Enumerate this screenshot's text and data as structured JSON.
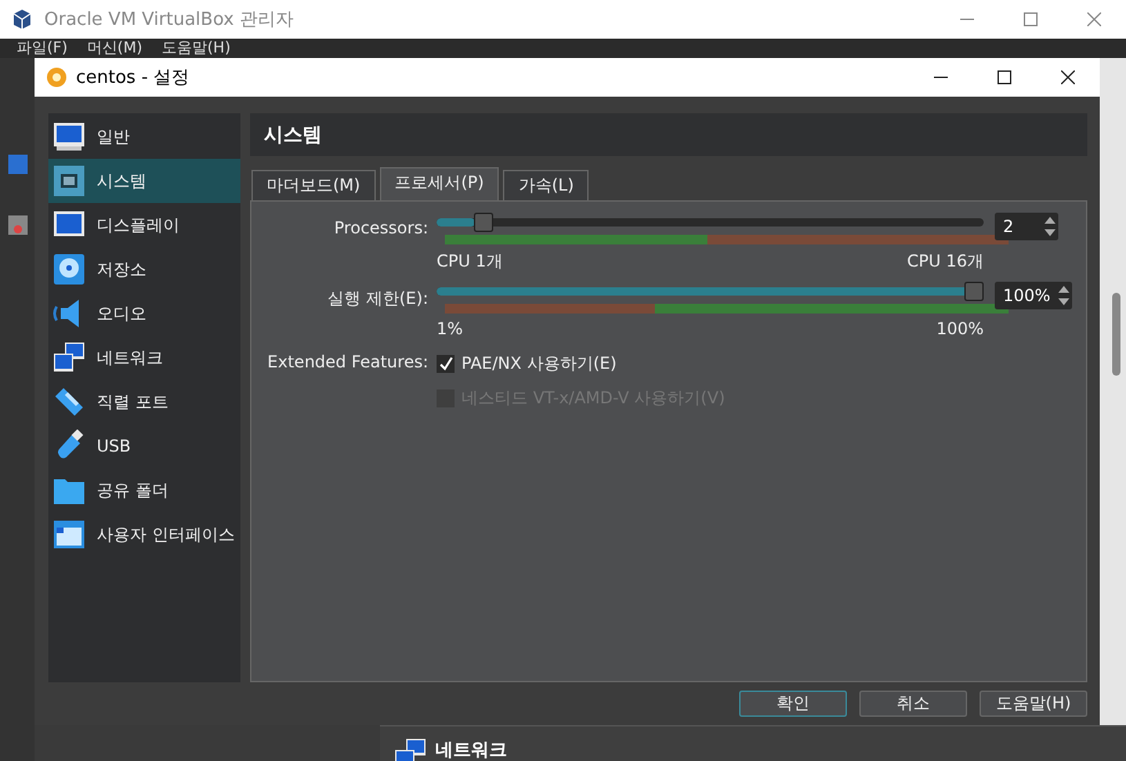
{
  "main_window": {
    "title": "Oracle VM VirtualBox 관리자",
    "menu": [
      "파일(F)",
      "머신(M)",
      "도움말(H)"
    ],
    "details_header": "네트워크"
  },
  "dialog": {
    "title": "centos - 설정",
    "sidebar": {
      "items": [
        {
          "label": "일반",
          "kind": "general",
          "selected": false
        },
        {
          "label": "시스템",
          "kind": "system",
          "selected": true
        },
        {
          "label": "디스플레이",
          "kind": "display",
          "selected": false
        },
        {
          "label": "저장소",
          "kind": "storage",
          "selected": false
        },
        {
          "label": "오디오",
          "kind": "audio",
          "selected": false
        },
        {
          "label": "네트워크",
          "kind": "network",
          "selected": false
        },
        {
          "label": "직렬 포트",
          "kind": "serial",
          "selected": false
        },
        {
          "label": "USB",
          "kind": "usb",
          "selected": false
        },
        {
          "label": "공유 폴더",
          "kind": "folder",
          "selected": false
        },
        {
          "label": "사용자 인터페이스",
          "kind": "ui",
          "selected": false
        }
      ]
    },
    "page_title": "시스템",
    "tabs": [
      {
        "label": "마더보드(M)",
        "selected": false
      },
      {
        "label": "프로세서(P)",
        "selected": true
      },
      {
        "label": "가속(L)",
        "selected": false
      }
    ],
    "sliders": [
      {
        "label": "Processors:",
        "level": 0.07,
        "value": "2",
        "min_label": "CPU 1개",
        "max_label": "CPU 16개"
      },
      {
        "label": "실행 제한(E):",
        "level": 1.0,
        "value": "100%",
        "min_label": "1%",
        "max_label": "100%"
      }
    ],
    "extended_features": {
      "label": "Extended Features:",
      "options": [
        {
          "label": "PAE/NX 사용하기(E)",
          "checked": true,
          "disabled": false
        },
        {
          "label": "네스티드 VT-x/AMD-V 사용하기(V)",
          "checked": false,
          "disabled": true
        }
      ]
    },
    "buttons": [
      {
        "label": "확인",
        "selected": true
      },
      {
        "label": "취소",
        "selected": false
      },
      {
        "label": "도움말(H)",
        "selected": false
      }
    ]
  }
}
